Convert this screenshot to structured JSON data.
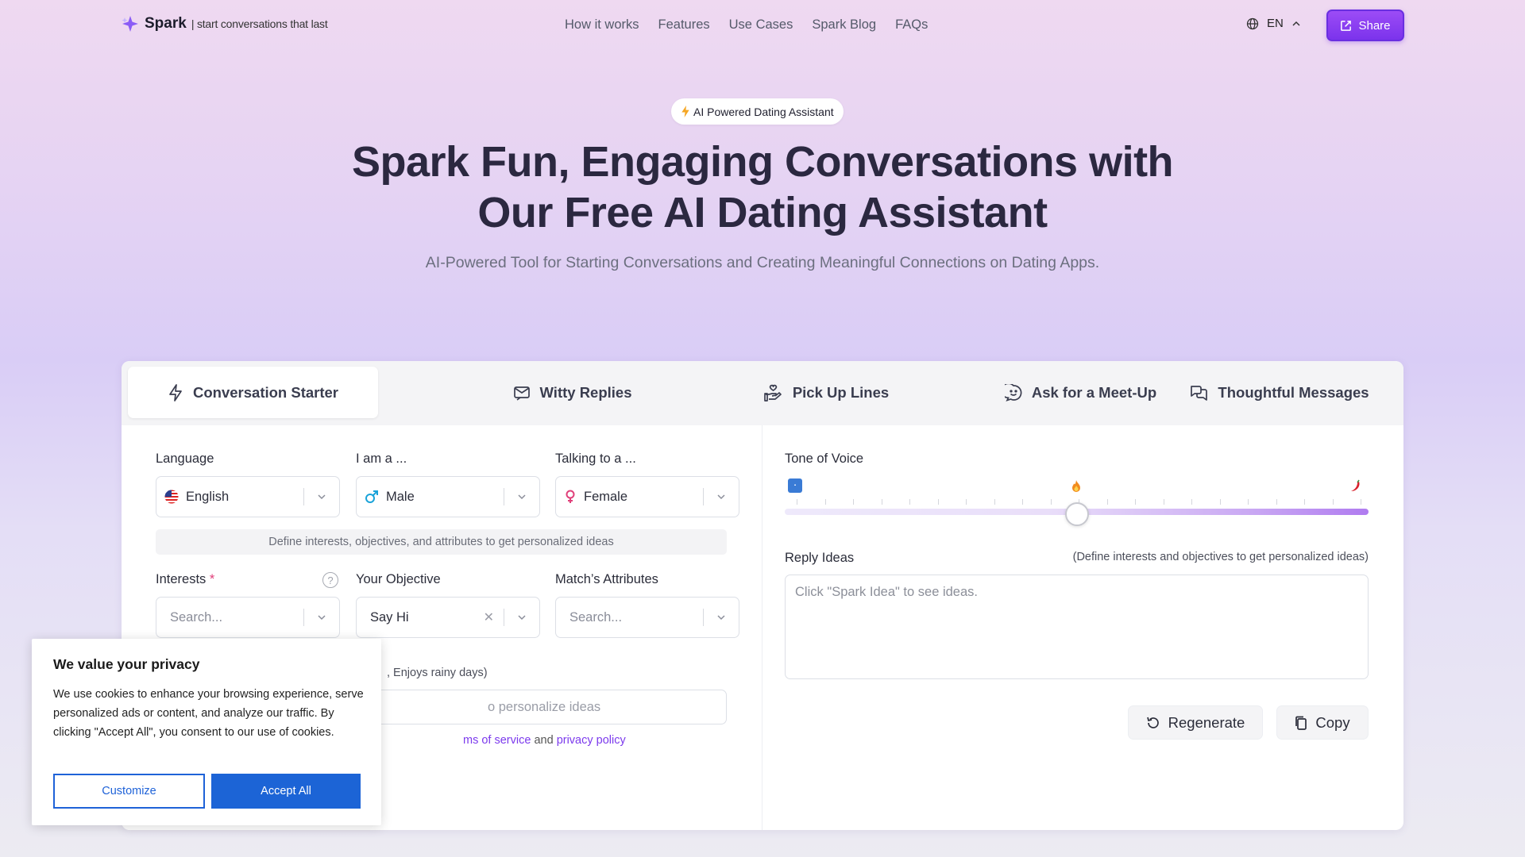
{
  "brand": {
    "name": "Spark",
    "tagline": "| start conversations that last"
  },
  "nav": {
    "items": [
      "How it works",
      "Features",
      "Use Cases",
      "Spark Blog",
      "FAQs"
    ],
    "language": "EN",
    "share_label": "Share"
  },
  "hero": {
    "badge": "AI Powered Dating Assistant",
    "title_line1": "Spark Fun, Engaging Conversations with",
    "title_line2": "Our Free AI Dating Assistant",
    "subtitle": "AI-Powered Tool for Starting Conversations and Creating Meaningful Connections on Dating Apps."
  },
  "tabs": [
    {
      "label": "Conversation Starter",
      "icon": "lightning-icon",
      "active": true
    },
    {
      "label": "Witty Replies",
      "icon": "message-icon",
      "active": false
    },
    {
      "label": "Pick Up Lines",
      "icon": "hand-heart-icon",
      "active": false
    },
    {
      "label": "Ask for a Meet-Up",
      "icon": "chat-bubble-icon",
      "active": false
    },
    {
      "label": "Thoughtful Messages",
      "icon": "chat-bubbles-icon",
      "active": false
    }
  ],
  "form": {
    "language_label": "Language",
    "language_value": "English",
    "iam_label": "I am a ...",
    "iam_value": "Male",
    "talking_label": "Talking to a ...",
    "talking_value": "Female",
    "hint": "Define interests, objectives, and attributes to get personalized ideas",
    "interests_label": "Interests",
    "interests_required": "*",
    "interests_placeholder": "Search...",
    "help_glyph": "?",
    "objective_label": "Your Objective",
    "objective_value": "Say Hi",
    "attributes_label": "Match’s Attributes",
    "attributes_placeholder": "Search...",
    "partial_example": ", Enjoys rainy days)",
    "partial_input_placeholder": "o personalize ideas",
    "legal_terms": "ms of service",
    "legal_and": "and",
    "legal_privacy": "privacy policy"
  },
  "tone": {
    "label": "Tone of Voice",
    "level": 0.5,
    "icons": [
      "cool-icon",
      "fire-icon",
      "chili-icon"
    ]
  },
  "reply": {
    "label": "Reply Ideas",
    "note": "(Define interests and objectives to get personalized ideas)",
    "placeholder": "Click \"Spark Idea\" to see ideas."
  },
  "actions": {
    "regenerate": "Regenerate",
    "copy": "Copy"
  },
  "cookie": {
    "title": "We value your privacy",
    "body": "We use cookies to enhance your browsing experience, serve personalized ads or content, and analyze our traffic. By clicking \"Accept All\", you consent to our use of cookies.",
    "customize": "Customize",
    "accept": "Accept All"
  },
  "colors": {
    "accent": "#7b33ec",
    "cookie_blue": "#1c64d6",
    "link": "#7c3aed"
  }
}
